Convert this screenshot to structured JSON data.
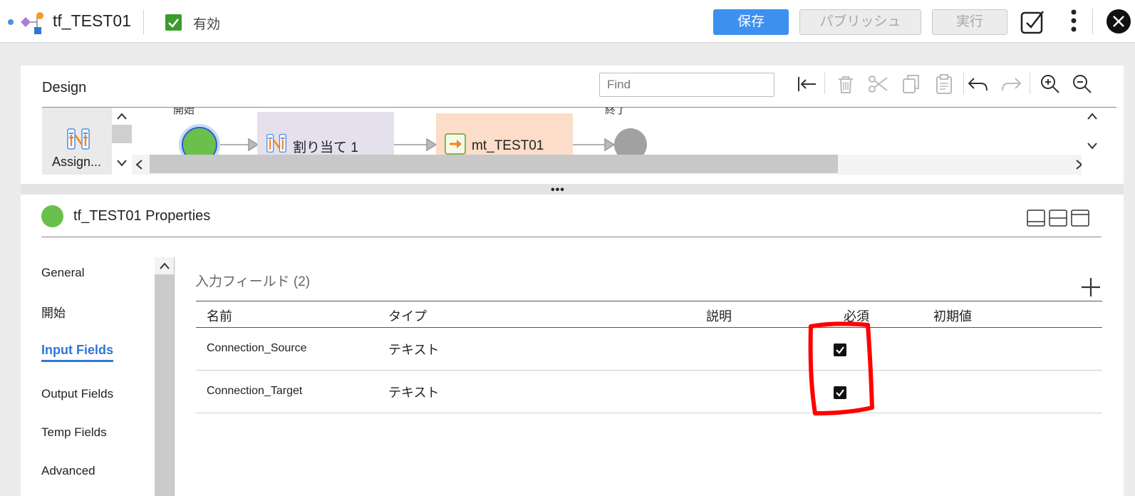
{
  "header": {
    "title": "tf_TEST01",
    "status_label": "有効",
    "save_label": "保存",
    "publish_label": "パブリッシュ",
    "run_label": "実行"
  },
  "design": {
    "title": "Design",
    "find_placeholder": "Find",
    "palette_label": "Assign...",
    "nodes": {
      "start_label": "開始",
      "assign_label": "割り当て 1",
      "mapping_label": "mt_TEST01",
      "end_label": "終了"
    }
  },
  "properties": {
    "title": "tf_TEST01 Properties",
    "nav": [
      "General",
      "開始",
      "Input Fields",
      "Output Fields",
      "Temp Fields",
      "Advanced"
    ],
    "active_nav": "Input Fields",
    "section_title": "入力フィールド (2)",
    "columns": [
      "名前",
      "タイプ",
      "説明",
      "必須",
      "初期値"
    ],
    "rows": [
      {
        "name": "Connection_Source",
        "type": "テキスト",
        "description": "",
        "required": true,
        "initial": ""
      },
      {
        "name": "Connection_Target",
        "type": "テキスト",
        "description": "",
        "required": true,
        "initial": ""
      }
    ]
  },
  "colors": {
    "accent": "#3d8ff0",
    "active_nav": "#2f76d9",
    "start_node": "#6ac04a",
    "valid_check": "#3d9a2f",
    "annotation": "#ff0000"
  }
}
